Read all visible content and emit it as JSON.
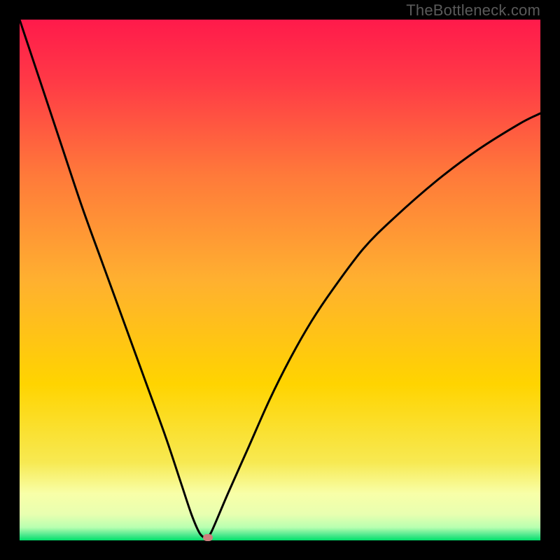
{
  "watermark": {
    "text": "TheBottleneck.com"
  },
  "chart_data": {
    "type": "line",
    "title": "",
    "xlabel": "",
    "ylabel": "",
    "xlim": [
      0,
      100
    ],
    "ylim": [
      0,
      100
    ],
    "grid": false,
    "background_gradient": {
      "top_color": "#ff1a4b",
      "mid_color": "#ffd400",
      "bottom_band_color": "#f8ffa8",
      "baseline_color": "#00e06a"
    },
    "series": [
      {
        "name": "bottleneck-curve",
        "color": "#000000",
        "x": [
          0,
          4,
          8,
          12,
          16,
          20,
          24,
          28,
          31,
          33,
          34.5,
          35.5,
          36,
          37,
          40,
          44,
          48,
          52,
          56,
          60,
          66,
          72,
          80,
          88,
          96,
          100
        ],
        "values": [
          100,
          88,
          76,
          64,
          53,
          42,
          31,
          20,
          11,
          5,
          1.5,
          0.5,
          0.5,
          2,
          9,
          18,
          27,
          35,
          42,
          48,
          56,
          62,
          69,
          75,
          80,
          82
        ]
      }
    ],
    "marker": {
      "name": "optimal-point",
      "x": 36.2,
      "y": 0.6,
      "color": "#cc7f7d"
    }
  }
}
